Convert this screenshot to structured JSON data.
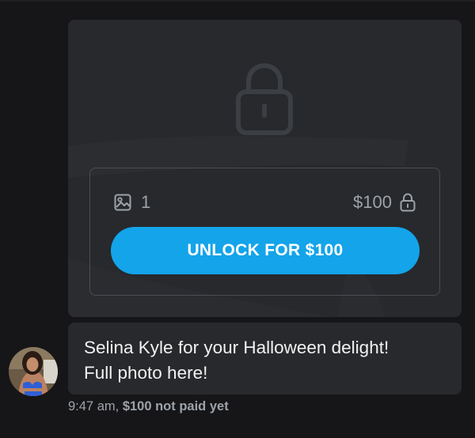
{
  "post": {
    "media_count": "1",
    "price": "$100",
    "unlock_button_label": "UNLOCK FOR $100"
  },
  "message": {
    "lines": [
      "Selina Kyle for your Halloween delight!",
      "Full photo here!"
    ]
  },
  "meta": {
    "time": "9:47 am,",
    "payment_status": "$100 not paid yet"
  },
  "colors": {
    "background": "#161618",
    "card": "#27292c",
    "accent": "#14a4ea",
    "muted_text": "#9ea3aa"
  },
  "icons": {
    "large": "lock-icon",
    "media": "image-icon",
    "price": "small-lock-icon"
  }
}
